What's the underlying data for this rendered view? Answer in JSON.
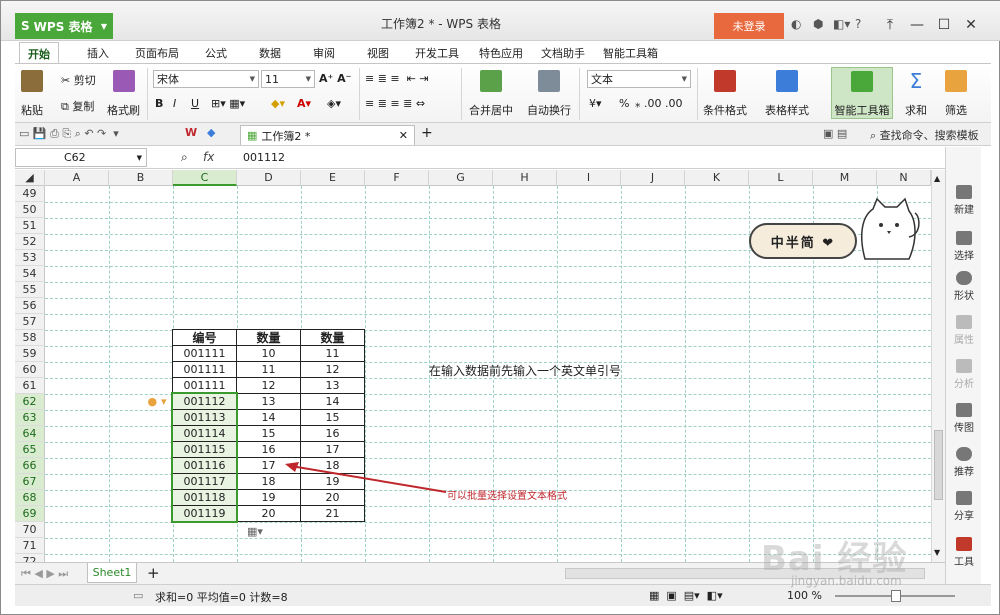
{
  "titlebar": {
    "app_label": "WPS 表格",
    "title": "工作簿2 * - WPS 表格",
    "login_label": "未登录",
    "help_label": "?"
  },
  "menu_tabs": [
    "开始",
    "插入",
    "页面布局",
    "公式",
    "数据",
    "审阅",
    "视图",
    "开发工具",
    "特色应用",
    "文档助手",
    "智能工具箱"
  ],
  "ribbon": {
    "paste": "粘贴",
    "cut": "剪切",
    "copy": "复制",
    "format_painter": "格式刷",
    "font_name": "宋体",
    "font_size": "11",
    "merge_center": "合并居中",
    "wrap_text": "自动换行",
    "number_format": "文本",
    "percent": "%",
    "conditional_format": "条件格式",
    "table_style": "表格样式",
    "smart_toolbox": "智能工具箱",
    "sum": "求和",
    "filter": "筛选"
  },
  "quickaccess": {
    "doc_tab": "工作簿2 *",
    "search": "查找命令、搜索模板"
  },
  "formula_bar": {
    "cell_ref": "C62",
    "fx": "fx",
    "value": "001112"
  },
  "columns": [
    "A",
    "B",
    "C",
    "D",
    "E",
    "F",
    "G",
    "H",
    "I",
    "J",
    "K",
    "L",
    "M",
    "N"
  ],
  "rows": [
    "49",
    "50",
    "51",
    "52",
    "53",
    "54",
    "55",
    "56",
    "57",
    "58",
    "59",
    "60",
    "61",
    "62",
    "63",
    "64",
    "65",
    "66",
    "67",
    "68",
    "69",
    "70",
    "71",
    "72"
  ],
  "table": {
    "headers": [
      "编号",
      "数量",
      "数量"
    ],
    "rows": [
      [
        "001111",
        "10",
        "11"
      ],
      [
        "001111",
        "11",
        "12"
      ],
      [
        "001111",
        "12",
        "13"
      ],
      [
        "001112",
        "13",
        "14"
      ],
      [
        "001113",
        "14",
        "15"
      ],
      [
        "001114",
        "15",
        "16"
      ],
      [
        "001115",
        "16",
        "17"
      ],
      [
        "001116",
        "17",
        "18"
      ],
      [
        "001117",
        "18",
        "19"
      ],
      [
        "001118",
        "19",
        "20"
      ],
      [
        "001119",
        "20",
        "21"
      ]
    ]
  },
  "notes": {
    "tip": "在输入数据前先输入一个英文单引号",
    "arrow_label": "可以批量选择设置文本格式"
  },
  "sticker": "中半简 ❤",
  "right_sidebar": [
    "新建",
    "选择",
    "形状",
    "属性",
    "分析",
    "传图",
    "推荐",
    "分享",
    "工具"
  ],
  "sheet_tabs": [
    "Sheet1"
  ],
  "statusbar": {
    "summary": "求和=0  平均值=0  计数=8",
    "zoom": "100 %"
  },
  "watermark": "Bai 经验",
  "watermark_url": "jingyan.baidu.com",
  "colors": {
    "accent_green": "#4aa83a",
    "login_orange": "#e8693e",
    "note_red": "#c0272d"
  }
}
